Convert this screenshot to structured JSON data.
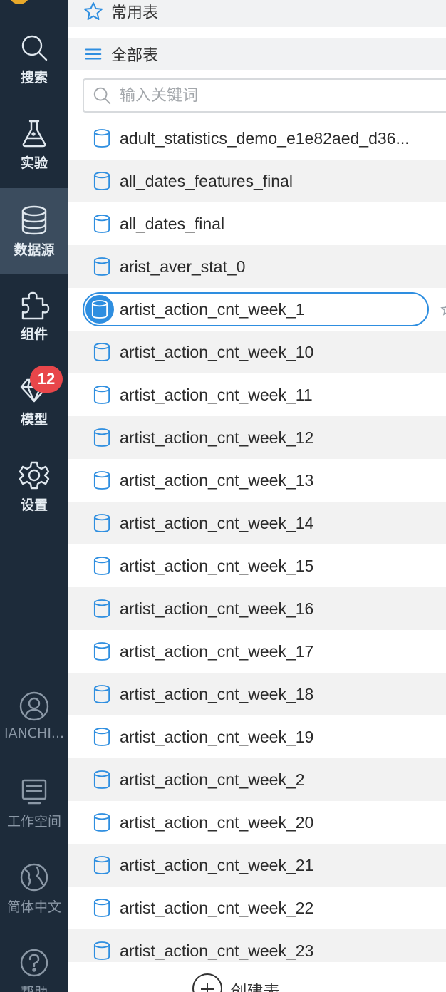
{
  "rail": {
    "items": [
      {
        "label": "搜索",
        "icon": "search-icon"
      },
      {
        "label": "实验",
        "icon": "flask-icon"
      },
      {
        "label": "数据源",
        "icon": "database-icon",
        "active": true
      },
      {
        "label": "组件",
        "icon": "puzzle-icon"
      },
      {
        "label": "模型",
        "icon": "diamond-icon",
        "badge": "12"
      },
      {
        "label": "设置",
        "icon": "gear-icon"
      }
    ],
    "lower_items": [
      {
        "label": "IANCHI...",
        "icon": "user-icon"
      },
      {
        "label": "工作空间",
        "icon": "workspace-icon"
      },
      {
        "label": "简体中文",
        "icon": "globe-icon"
      },
      {
        "label": "帮助",
        "icon": "help-icon"
      }
    ],
    "colors": {
      "background": "#1d2b3a",
      "active": "#3b4c5e",
      "badge": "#e8464a"
    }
  },
  "panel": {
    "favorites_label": "常用表",
    "all_tables_label": "全部表",
    "search_placeholder": "输入关键词",
    "tables": [
      "adult_statistics_demo_e1e82aed_d36...",
      "all_dates_features_final",
      "all_dates_final",
      "arist_aver_stat_0",
      "artist_action_cnt_week_1",
      "artist_action_cnt_week_10",
      "artist_action_cnt_week_11",
      "artist_action_cnt_week_12",
      "artist_action_cnt_week_13",
      "artist_action_cnt_week_14",
      "artist_action_cnt_week_15",
      "artist_action_cnt_week_16",
      "artist_action_cnt_week_17",
      "artist_action_cnt_week_18",
      "artist_action_cnt_week_19",
      "artist_action_cnt_week_2",
      "artist_action_cnt_week_20",
      "artist_action_cnt_week_21",
      "artist_action_cnt_week_22",
      "artist_action_cnt_week_23"
    ],
    "selected_table": "artist_action_cnt_week_1",
    "create_table_label": "创建表",
    "colors": {
      "accent": "#2e8ee0",
      "row_alt": "#f2f2f2",
      "header_bg": "#f1f2f3"
    }
  }
}
